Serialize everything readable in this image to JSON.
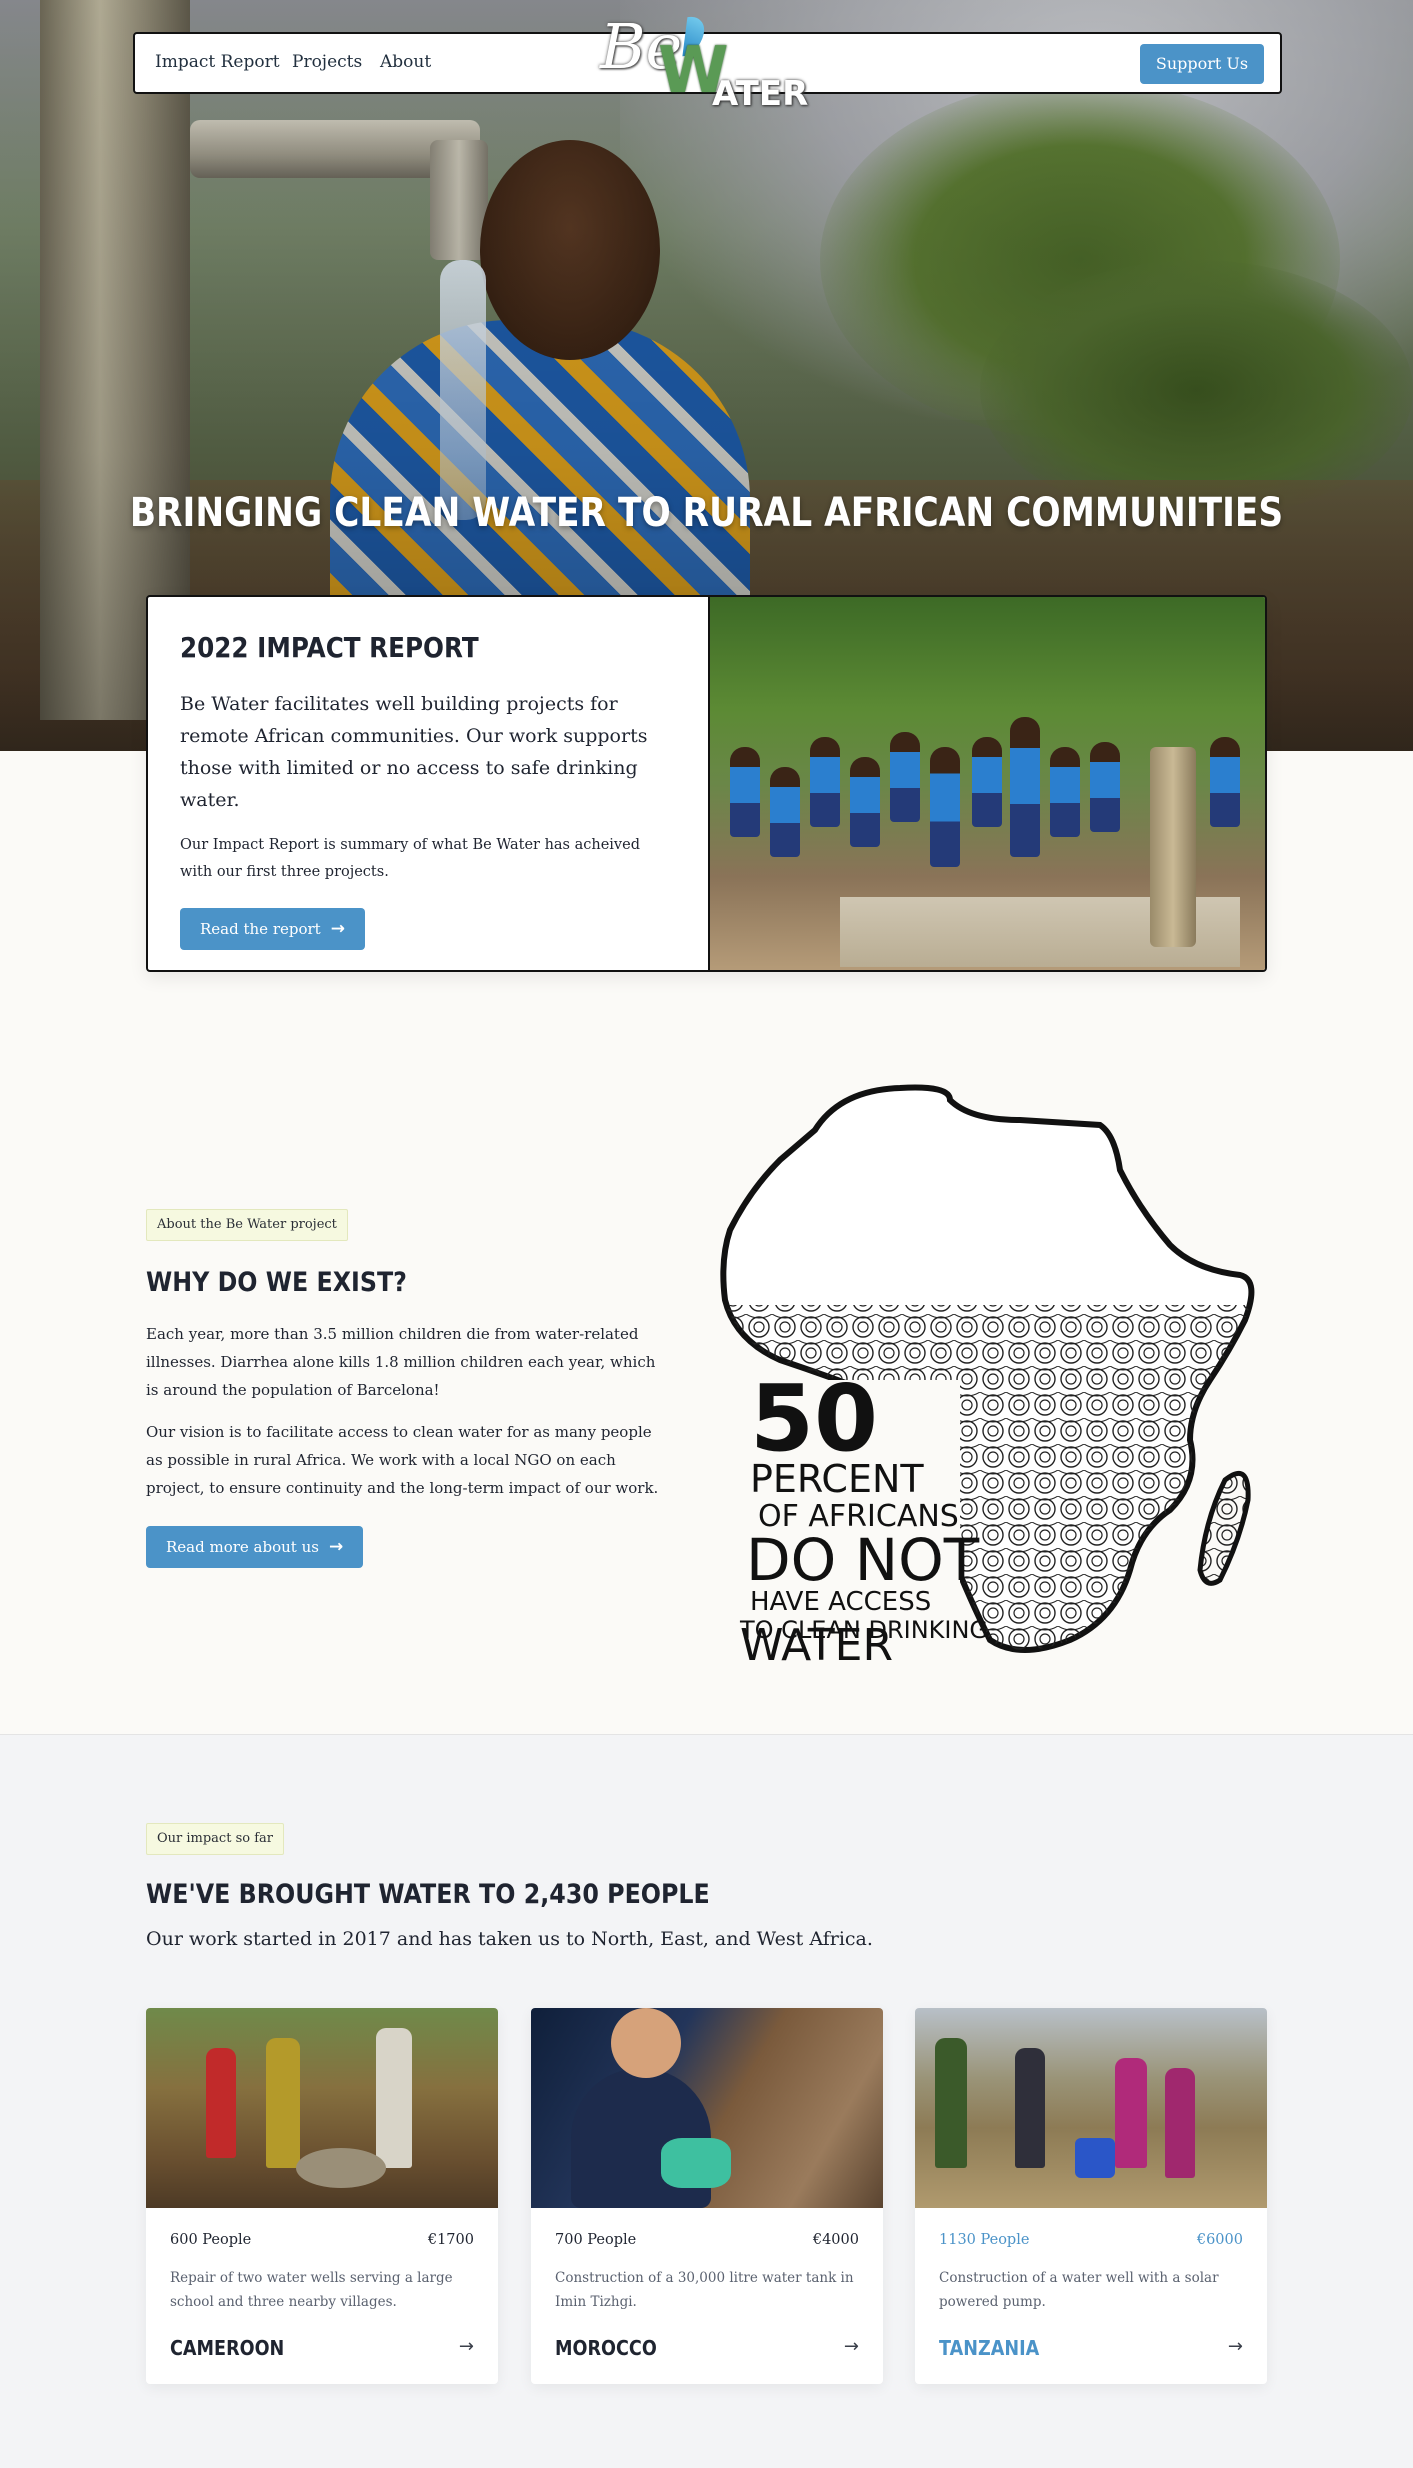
{
  "nav": {
    "links": [
      "Impact Report",
      "Projects",
      "About"
    ],
    "support_label": "Support Us",
    "logo": {
      "be": "Be",
      "w": "W",
      "ater": "ATER"
    }
  },
  "hero": {
    "title": "BRINGING CLEAN WATER TO RURAL AFRICAN COMMUNITIES"
  },
  "impact_report": {
    "title": "2022 IMPACT REPORT",
    "lead": "Be Water facilitates well building projects for remote African communities. Our work supports those with limited or no access to safe drinking water.",
    "small": "Our Impact Report is summary of what Be Water has acheived with our first three projects.",
    "button_label": "Read the report"
  },
  "about": {
    "tag": "About the Be Water project",
    "heading": "WHY DO WE EXIST?",
    "paragraphs": [
      "Each year, more than 3.5 million children die from water-related illnesses. Diarrhea alone kills 1.8 million children each year, which is around the population of Barcelona!",
      "Our vision is to facilitate access to clean water for as many people as possible in rural Africa. We work with a local NGO on each project, to ensure continuity and the long-term impact of our work."
    ],
    "button_label": "Read more about us",
    "illustration_text": [
      "50",
      "PERCENT",
      "OF AFRICANS",
      "DO NOT",
      "HAVE ACCESS",
      "TO CLEAN DRINKING",
      "WATER"
    ]
  },
  "impact": {
    "tag": "Our impact so far",
    "heading": "WE'VE BROUGHT WATER TO 2,430 PEOPLE",
    "subtitle": "Our work started in 2017 and has taken us to North, East, and West Africa.",
    "projects": [
      {
        "people": "600 People",
        "cost": "€1700",
        "description": "Repair of two water wells serving a large school and three nearby villages.",
        "country": "CAMEROON"
      },
      {
        "people": "700 People",
        "cost": "€4000",
        "description": "Construction of a 30,000 litre water tank in Imin Tizhgi.",
        "country": "MOROCCO"
      },
      {
        "people": "1130 People",
        "cost": "€6000",
        "description": "Construction of a water well with a solar powered pump.",
        "country": "TANZANIA"
      }
    ]
  },
  "colors": {
    "accent": "#4b93c8",
    "tag_bg": "#f6f9e0",
    "text": "#1f2430",
    "muted": "#5b6270"
  },
  "icons": {
    "button_arrow": "arrow-right-icon",
    "card_arrow": "arrow-right-icon"
  }
}
